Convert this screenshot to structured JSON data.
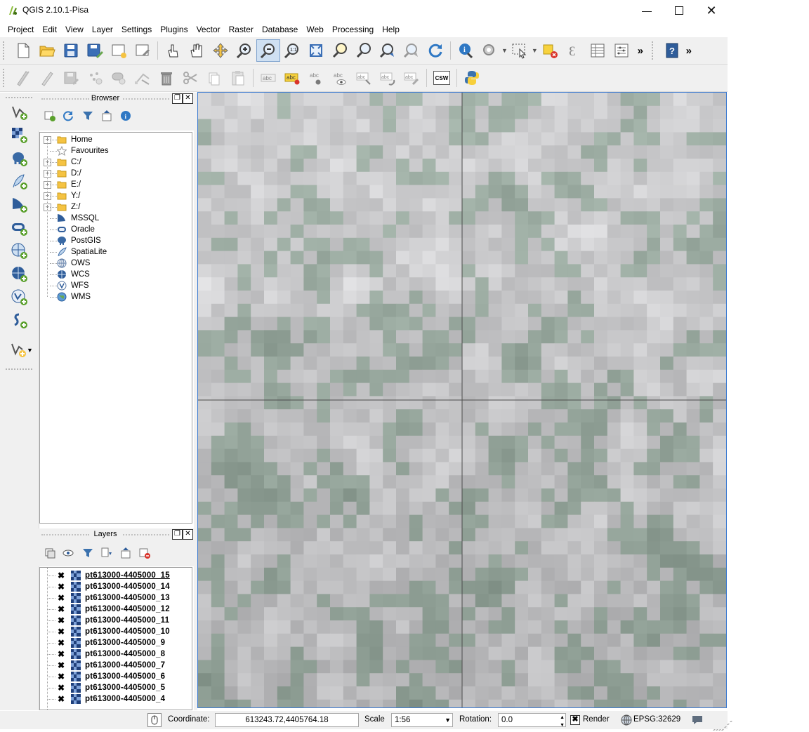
{
  "window": {
    "title": "QGIS 2.10.1-Pisa",
    "controls": [
      "minimize",
      "maximize",
      "close"
    ]
  },
  "menubar": {
    "items": [
      "Project",
      "Edit",
      "View",
      "Layer",
      "Settings",
      "Plugins",
      "Vector",
      "Raster",
      "Database",
      "Web",
      "Processing",
      "Help"
    ]
  },
  "toolbar_labels": {
    "csw": "CSW",
    "abc": "abc",
    "more": "»"
  },
  "browser_panel": {
    "title": "Browser",
    "items": [
      {
        "label": "Home",
        "icon": "folder-icon",
        "expandable": true
      },
      {
        "label": "Favourites",
        "icon": "star-icon",
        "expandable": false
      },
      {
        "label": "C:/",
        "icon": "folder-icon",
        "expandable": true
      },
      {
        "label": "D:/",
        "icon": "folder-icon",
        "expandable": true
      },
      {
        "label": "E:/",
        "icon": "folder-icon",
        "expandable": true
      },
      {
        "label": "Y:/",
        "icon": "folder-icon",
        "expandable": true
      },
      {
        "label": "Z:/",
        "icon": "folder-icon",
        "expandable": true
      },
      {
        "label": "MSSQL",
        "icon": "mssql-icon",
        "expandable": false
      },
      {
        "label": "Oracle",
        "icon": "oracle-icon",
        "expandable": false
      },
      {
        "label": "PostGIS",
        "icon": "postgis-icon",
        "expandable": false
      },
      {
        "label": "SpatiaLite",
        "icon": "spatialite-icon",
        "expandable": false
      },
      {
        "label": "OWS",
        "icon": "ows-icon",
        "expandable": false
      },
      {
        "label": "WCS",
        "icon": "wcs-icon",
        "expandable": false
      },
      {
        "label": "WFS",
        "icon": "wfs-icon",
        "expandable": false
      },
      {
        "label": "WMS",
        "icon": "wms-icon",
        "expandable": false
      }
    ]
  },
  "layers_panel": {
    "title": "Layers",
    "layers": [
      {
        "name": "pt613000-4405000_15",
        "checked": true,
        "selected": true
      },
      {
        "name": "pt613000-4405000_14",
        "checked": true
      },
      {
        "name": "pt613000-4405000_13",
        "checked": true
      },
      {
        "name": "pt613000-4405000_12",
        "checked": true
      },
      {
        "name": "pt613000-4405000_11",
        "checked": true
      },
      {
        "name": "pt613000-4405000_10",
        "checked": true
      },
      {
        "name": "pt613000-4405000_9",
        "checked": true
      },
      {
        "name": "pt613000-4405000_8",
        "checked": true
      },
      {
        "name": "pt613000-4405000_7",
        "checked": true
      },
      {
        "name": "pt613000-4405000_6",
        "checked": true
      },
      {
        "name": "pt613000-4405000_5",
        "checked": true
      },
      {
        "name": "pt613000-4405000_4",
        "checked": true
      }
    ]
  },
  "statusbar": {
    "coordinate_label": "Coordinate:",
    "coordinate_value": "613243.72,4405764.18",
    "scale_label": "Scale",
    "scale_value": "1:56",
    "rotation_label": "Rotation:",
    "rotation_value": "0.0",
    "render_label": "Render",
    "render_checked": true,
    "crs": "EPSG:32629"
  },
  "colors": {
    "map_border": "#3d7bd1",
    "accent_green": "#5aa02c"
  }
}
